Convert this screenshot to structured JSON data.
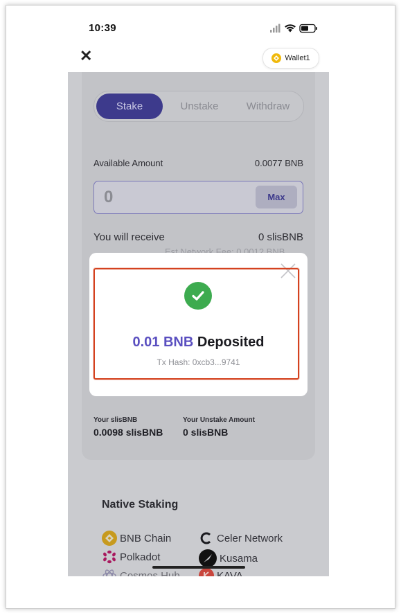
{
  "status": {
    "time": "10:39"
  },
  "header": {
    "wallet_label": "Wallet1"
  },
  "tabs": [
    {
      "label": "Stake",
      "active": true
    },
    {
      "label": "Unstake",
      "active": false
    },
    {
      "label": "Withdraw",
      "active": false
    }
  ],
  "stake": {
    "available_label": "Available Amount",
    "available_value": "0.0077 BNB",
    "input_value": "0",
    "max_label": "Max",
    "receive_label": "You will receive",
    "receive_value": "0 slisBNB",
    "fee_text": "Est Network Fee: 0.0012 BNB"
  },
  "stats": {
    "your_label": "Your slisBNB",
    "your_value": "0.0098 slisBNB",
    "unstake_label": "Your Unstake Amount",
    "unstake_value": "0 slisBNB"
  },
  "native_staking": {
    "title": "Native Staking",
    "chains": [
      {
        "name": "BNB Chain",
        "icon": "bnb-icon"
      },
      {
        "name": "Celer Network",
        "icon": "celer-icon"
      },
      {
        "name": "Polkadot",
        "icon": "polkadot-icon"
      },
      {
        "name": "Kusama",
        "icon": "kusama-icon"
      },
      {
        "name": "Cosmos Hub",
        "icon": "cosmos-icon"
      },
      {
        "name": "KAVA",
        "icon": "kava-icon"
      }
    ]
  },
  "modal": {
    "amount": "0.01 BNB",
    "word": "Deposited",
    "tx_hash": "Tx Hash: 0xcb3...9741"
  },
  "colors": {
    "accent": "#3d3a8c",
    "success": "#3dab4f",
    "highlight": "#d4421f"
  }
}
